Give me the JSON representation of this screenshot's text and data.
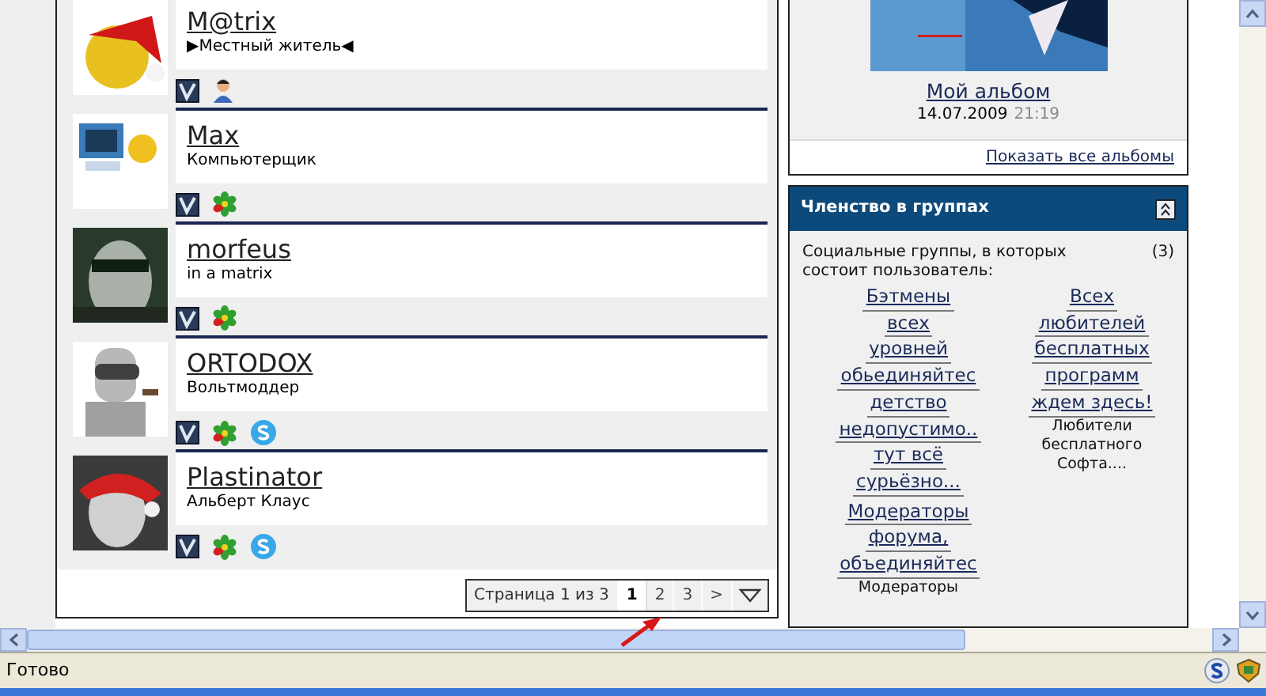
{
  "members": [
    {
      "name": "M@trix",
      "title": "▶Местный житель◀",
      "avatar": {
        "kind": "picture"
      },
      "icons": [
        {
          "kind": "v-badge"
        },
        {
          "kind": "person"
        }
      ]
    },
    {
      "name": "Max",
      "title": "Компьютерщик",
      "avatar": {
        "kind": "picture"
      },
      "icons": [
        {
          "kind": "v-badge"
        },
        {
          "kind": "flower"
        }
      ]
    },
    {
      "name": "morfeus",
      "title": "in a matrix",
      "avatar": {
        "kind": "picture"
      },
      "icons": [
        {
          "kind": "v-badge"
        },
        {
          "kind": "flower"
        }
      ]
    },
    {
      "name": "ORTODOX",
      "title": "Вольтмоддер",
      "avatar": {
        "kind": "picture"
      },
      "icons": [
        {
          "kind": "v-badge"
        },
        {
          "kind": "flower"
        },
        {
          "kind": "skype"
        }
      ]
    },
    {
      "name": "Plastinator",
      "title": "Альберт Клаус",
      "avatar": {
        "kind": "picture"
      },
      "icons": [
        {
          "kind": "v-badge"
        },
        {
          "kind": "flower"
        },
        {
          "kind": "skype"
        }
      ]
    }
  ],
  "pagination": {
    "label": "Страница 1 из 3",
    "pages": [
      {
        "label": "1",
        "selected": true
      },
      {
        "label": "2",
        "selected": false
      },
      {
        "label": "3",
        "selected": false
      }
    ],
    "next": ">"
  },
  "album": {
    "picture": {
      "kind": "picture"
    },
    "title": "Мой альбом",
    "date": "14.07.2009",
    "time": "21:19",
    "show_all": "Показать все альбомы"
  },
  "groups_panel": {
    "title": "Членство в группах",
    "intro": "Социальные группы, в которых состоит пользователь:",
    "count": "(3)",
    "columns": [
      [
        {
          "lines": [
            "Бэтмены",
            "всех",
            "уровней",
            "обьединяйтес",
            "детство",
            "недопустимо..",
            "тут всё",
            "сурьёзно..."
          ]
        },
        {
          "lines": [
            "Модераторы",
            "форума,",
            "объединяйтес"
          ],
          "description": [
            "Модераторы"
          ]
        }
      ],
      [
        {
          "lines": [
            "Всех",
            "любителей",
            "бесплатных",
            "программ",
            "ждем здесь!"
          ],
          "description": [
            "Любители",
            "бесплатного",
            "Софта...."
          ]
        }
      ]
    ]
  },
  "status_bar": {
    "text": "Готово"
  }
}
